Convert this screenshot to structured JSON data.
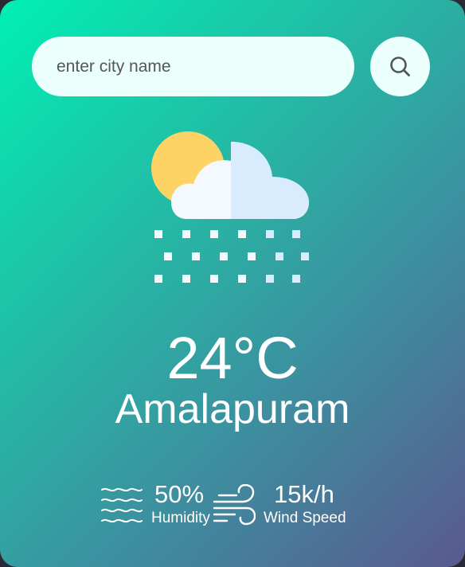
{
  "search": {
    "placeholder": "enter city name",
    "value": "",
    "button_icon": "search-icon"
  },
  "weather": {
    "icon": "cloud-sun-snow-icon",
    "temperature": "24°C",
    "city": "Amalapuram"
  },
  "details": {
    "humidity": {
      "icon": "water-waves-icon",
      "value": "50%",
      "label": "Humidity"
    },
    "wind": {
      "icon": "wind-icon",
      "value": "15k/h",
      "label": "Wind Speed"
    }
  },
  "colors": {
    "gradient_start": "#00f0b4",
    "gradient_end": "#5a5990",
    "input_background": "#ebfffc",
    "text": "#ffffff"
  }
}
